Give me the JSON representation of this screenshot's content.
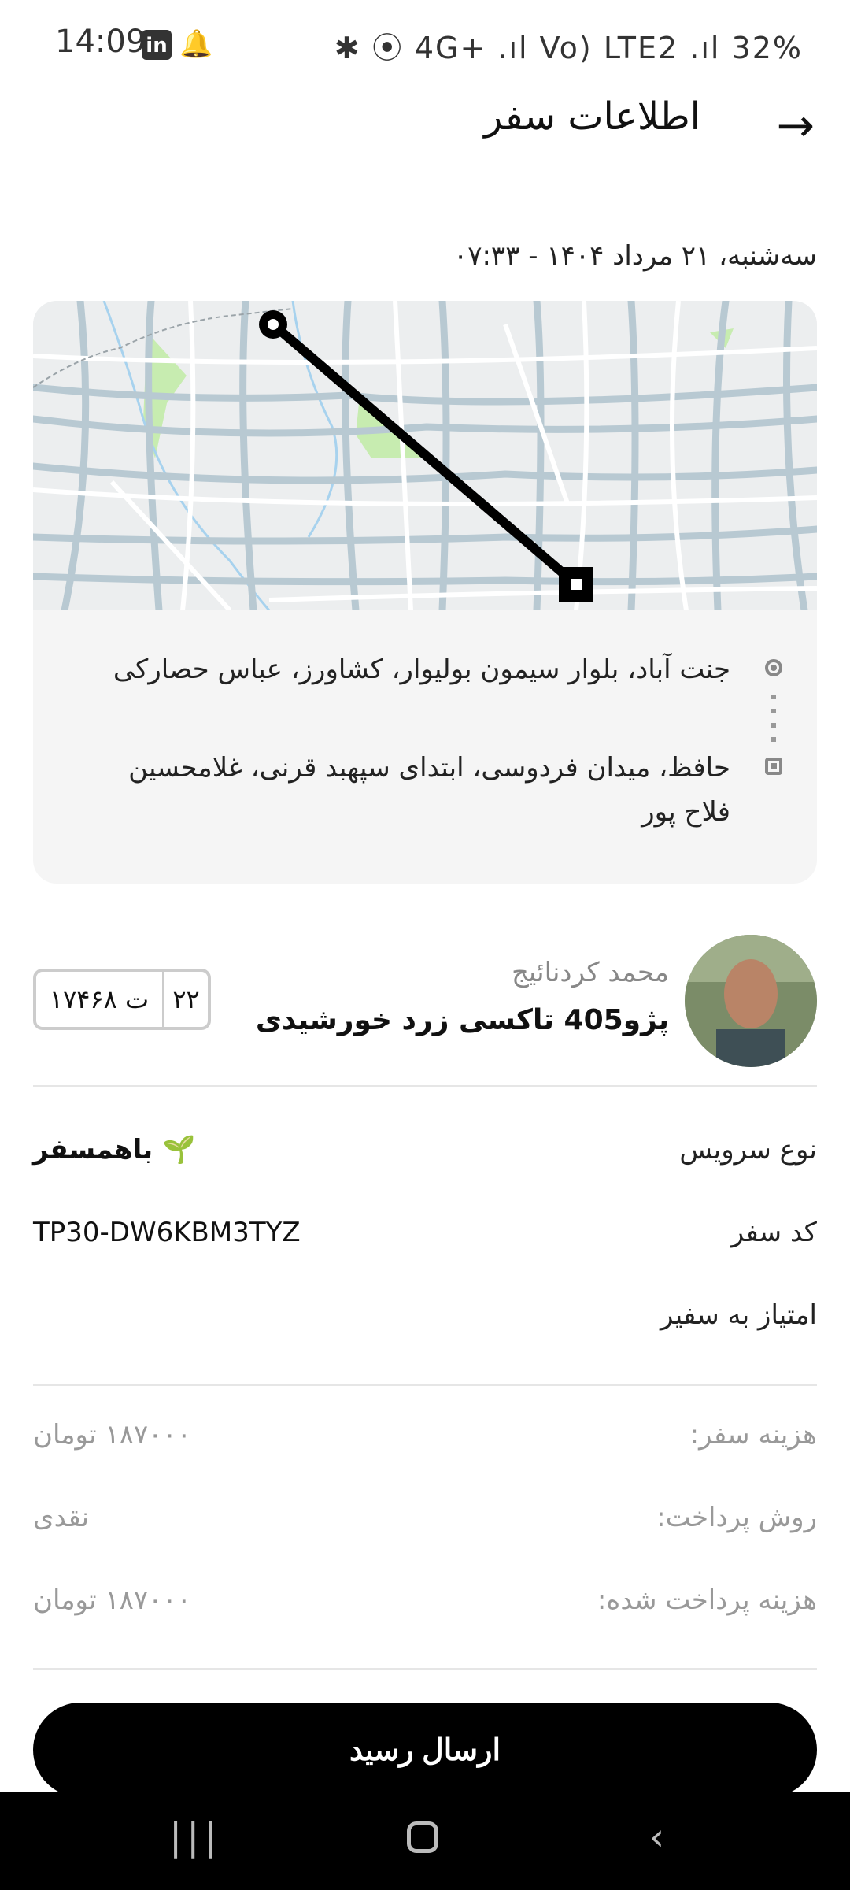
{
  "status_bar": {
    "time": "14:09",
    "right_text": "✱ ⦿ 4G+ .ıl Vo) LTE2 .ıl 32%",
    "battery": "32%",
    "linkedin_label": "in"
  },
  "header": {
    "title": "اطلاعات سفر",
    "back_icon": "arrow-right-icon"
  },
  "trip": {
    "date_time": "سه‌شنبه، ۲۱ مرداد ۱۴۰۴ - ۰۷:۳۳",
    "origin": "جنت آباد، بلوار سیمون بولیوار، کشاورز، عباس حصارکی",
    "destination": "حافظ، میدان فردوسی، ابتدای سپهبد قرنی، غلامحسین فلاح پور"
  },
  "driver": {
    "name": "محمد کردنائیج",
    "car": "پژو405 تاکسی زرد خورشیدی",
    "plate_main": "۱۷۴ت ۶۸",
    "plate_region": "۲۲"
  },
  "details": {
    "service_label": "نوع سرویس",
    "service_value": "باهمسفر",
    "code_label": "کد سفر",
    "code_value": "TP30-DW6KBM3TYZ",
    "rate_label": "امتیاز به سفیر"
  },
  "payment": {
    "fare_label": "هزینه سفر:",
    "fare_value": "۱۸۷۰۰۰  تومان",
    "method_label": "روش پرداخت:",
    "method_value": "نقدی",
    "paid_label": "هزینه پرداخت شده:",
    "paid_value": "۱۸۷۰۰۰  تومان"
  },
  "actions": {
    "send_receipt": "ارسال رسید"
  }
}
